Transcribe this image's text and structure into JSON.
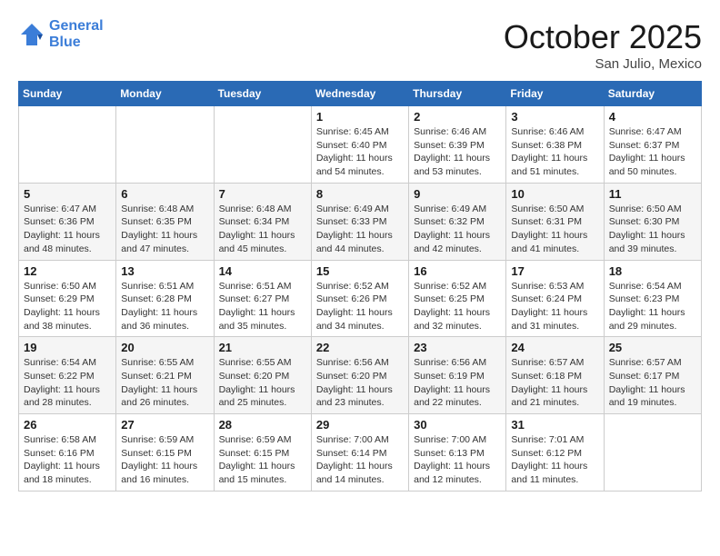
{
  "header": {
    "logo_line1": "General",
    "logo_line2": "Blue",
    "month": "October 2025",
    "location": "San Julio, Mexico"
  },
  "weekdays": [
    "Sunday",
    "Monday",
    "Tuesday",
    "Wednesday",
    "Thursday",
    "Friday",
    "Saturday"
  ],
  "weeks": [
    [
      {
        "day": "",
        "info": ""
      },
      {
        "day": "",
        "info": ""
      },
      {
        "day": "",
        "info": ""
      },
      {
        "day": "1",
        "info": "Sunrise: 6:45 AM\nSunset: 6:40 PM\nDaylight: 11 hours and 54 minutes."
      },
      {
        "day": "2",
        "info": "Sunrise: 6:46 AM\nSunset: 6:39 PM\nDaylight: 11 hours and 53 minutes."
      },
      {
        "day": "3",
        "info": "Sunrise: 6:46 AM\nSunset: 6:38 PM\nDaylight: 11 hours and 51 minutes."
      },
      {
        "day": "4",
        "info": "Sunrise: 6:47 AM\nSunset: 6:37 PM\nDaylight: 11 hours and 50 minutes."
      }
    ],
    [
      {
        "day": "5",
        "info": "Sunrise: 6:47 AM\nSunset: 6:36 PM\nDaylight: 11 hours and 48 minutes."
      },
      {
        "day": "6",
        "info": "Sunrise: 6:48 AM\nSunset: 6:35 PM\nDaylight: 11 hours and 47 minutes."
      },
      {
        "day": "7",
        "info": "Sunrise: 6:48 AM\nSunset: 6:34 PM\nDaylight: 11 hours and 45 minutes."
      },
      {
        "day": "8",
        "info": "Sunrise: 6:49 AM\nSunset: 6:33 PM\nDaylight: 11 hours and 44 minutes."
      },
      {
        "day": "9",
        "info": "Sunrise: 6:49 AM\nSunset: 6:32 PM\nDaylight: 11 hours and 42 minutes."
      },
      {
        "day": "10",
        "info": "Sunrise: 6:50 AM\nSunset: 6:31 PM\nDaylight: 11 hours and 41 minutes."
      },
      {
        "day": "11",
        "info": "Sunrise: 6:50 AM\nSunset: 6:30 PM\nDaylight: 11 hours and 39 minutes."
      }
    ],
    [
      {
        "day": "12",
        "info": "Sunrise: 6:50 AM\nSunset: 6:29 PM\nDaylight: 11 hours and 38 minutes."
      },
      {
        "day": "13",
        "info": "Sunrise: 6:51 AM\nSunset: 6:28 PM\nDaylight: 11 hours and 36 minutes."
      },
      {
        "day": "14",
        "info": "Sunrise: 6:51 AM\nSunset: 6:27 PM\nDaylight: 11 hours and 35 minutes."
      },
      {
        "day": "15",
        "info": "Sunrise: 6:52 AM\nSunset: 6:26 PM\nDaylight: 11 hours and 34 minutes."
      },
      {
        "day": "16",
        "info": "Sunrise: 6:52 AM\nSunset: 6:25 PM\nDaylight: 11 hours and 32 minutes."
      },
      {
        "day": "17",
        "info": "Sunrise: 6:53 AM\nSunset: 6:24 PM\nDaylight: 11 hours and 31 minutes."
      },
      {
        "day": "18",
        "info": "Sunrise: 6:54 AM\nSunset: 6:23 PM\nDaylight: 11 hours and 29 minutes."
      }
    ],
    [
      {
        "day": "19",
        "info": "Sunrise: 6:54 AM\nSunset: 6:22 PM\nDaylight: 11 hours and 28 minutes."
      },
      {
        "day": "20",
        "info": "Sunrise: 6:55 AM\nSunset: 6:21 PM\nDaylight: 11 hours and 26 minutes."
      },
      {
        "day": "21",
        "info": "Sunrise: 6:55 AM\nSunset: 6:20 PM\nDaylight: 11 hours and 25 minutes."
      },
      {
        "day": "22",
        "info": "Sunrise: 6:56 AM\nSunset: 6:20 PM\nDaylight: 11 hours and 23 minutes."
      },
      {
        "day": "23",
        "info": "Sunrise: 6:56 AM\nSunset: 6:19 PM\nDaylight: 11 hours and 22 minutes."
      },
      {
        "day": "24",
        "info": "Sunrise: 6:57 AM\nSunset: 6:18 PM\nDaylight: 11 hours and 21 minutes."
      },
      {
        "day": "25",
        "info": "Sunrise: 6:57 AM\nSunset: 6:17 PM\nDaylight: 11 hours and 19 minutes."
      }
    ],
    [
      {
        "day": "26",
        "info": "Sunrise: 6:58 AM\nSunset: 6:16 PM\nDaylight: 11 hours and 18 minutes."
      },
      {
        "day": "27",
        "info": "Sunrise: 6:59 AM\nSunset: 6:15 PM\nDaylight: 11 hours and 16 minutes."
      },
      {
        "day": "28",
        "info": "Sunrise: 6:59 AM\nSunset: 6:15 PM\nDaylight: 11 hours and 15 minutes."
      },
      {
        "day": "29",
        "info": "Sunrise: 7:00 AM\nSunset: 6:14 PM\nDaylight: 11 hours and 14 minutes."
      },
      {
        "day": "30",
        "info": "Sunrise: 7:00 AM\nSunset: 6:13 PM\nDaylight: 11 hours and 12 minutes."
      },
      {
        "day": "31",
        "info": "Sunrise: 7:01 AM\nSunset: 6:12 PM\nDaylight: 11 hours and 11 minutes."
      },
      {
        "day": "",
        "info": ""
      }
    ]
  ]
}
